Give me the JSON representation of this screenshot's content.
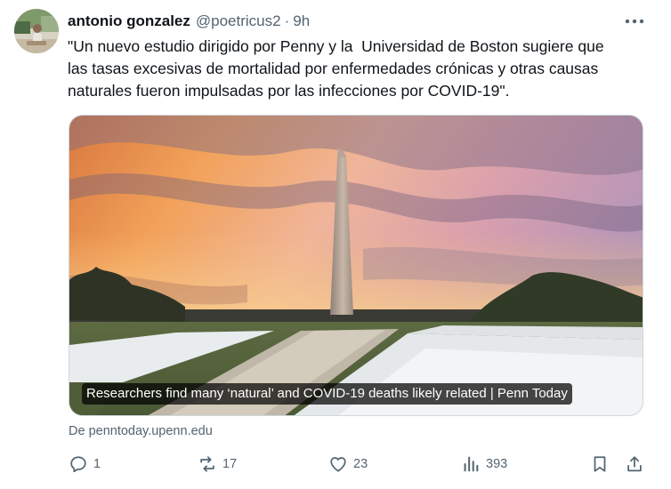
{
  "tweet": {
    "display_name": "antonio gonzalez",
    "handle": "@poetricus2",
    "separator": "·",
    "time": "9h",
    "text_lines": [
      "\"Un nuevo estudio dirigido por Penny y la  Universidad de Boston sugiere que",
      "las tasas excesivas de mortalidad por enfermedades crónicas y otras causas",
      "naturales fueron impulsadas por las infecciones por COVID-19\"."
    ]
  },
  "card": {
    "title": "Researchers find many ‘natural’ and COVID-19 deaths likely related | Penn Today",
    "source": "De penntoday.upenn.edu"
  },
  "actions": {
    "replies": "1",
    "reposts": "17",
    "likes": "23",
    "views": "393"
  },
  "icons": {
    "more": "more-dots-icon",
    "reply": "reply-icon",
    "repost": "repost-icon",
    "like": "heart-icon",
    "views": "views-chart-icon",
    "bookmark": "bookmark-icon",
    "share": "share-icon"
  },
  "colors": {
    "text_primary": "#0f1419",
    "text_secondary": "#536471",
    "border": "#cfd9de"
  }
}
